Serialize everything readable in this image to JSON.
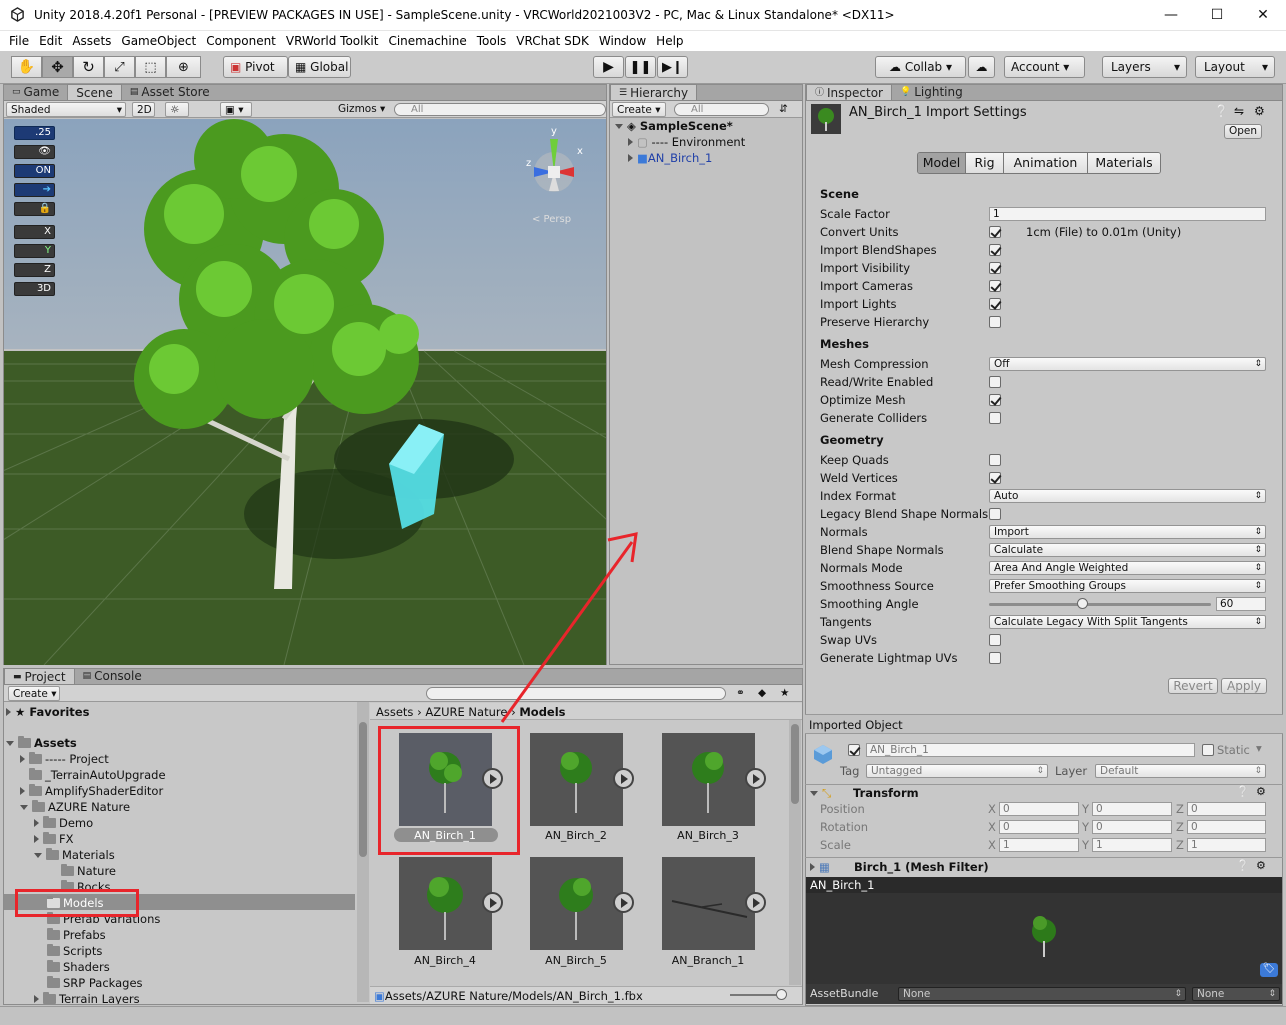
{
  "window": {
    "title": "Unity 2018.4.20f1 Personal - [PREVIEW PACKAGES IN USE] - SampleScene.unity - VRCWorld2021003V2 - PC, Mac & Linux Standalone* <DX11>",
    "minimize": "—",
    "maximize": "☐",
    "close": "✕"
  },
  "menu": [
    "File",
    "Edit",
    "Assets",
    "GameObject",
    "Component",
    "VRWorld Toolkit",
    "Cinemachine",
    "Tools",
    "VRChat SDK",
    "Window",
    "Help"
  ],
  "toolbar": {
    "pivot": "Pivot",
    "global": "Global",
    "collab": "Collab",
    "account": "Account",
    "layers": "Layers",
    "layout": "Layout"
  },
  "scene": {
    "tabs": [
      "Game",
      "Scene",
      "Asset Store"
    ],
    "shaded": "Shaded",
    "mode2d": "2D",
    "gizmos": "Gizmos",
    "search_placeholder": "All",
    "persp": "< Persp",
    "icons": [
      ".25",
      "",
      "ON",
      "",
      "",
      "X",
      "Y",
      "Z",
      "3D"
    ],
    "gizmo_axes": {
      "y": "y",
      "x": "x",
      "z": "z"
    }
  },
  "hierarchy": {
    "tab": "Hierarchy",
    "create": "Create",
    "search_placeholder": "All",
    "scene_name": "SampleScene*",
    "items": [
      "---- Environment",
      "AN_Birch_1"
    ]
  },
  "inspector": {
    "tab1": "Inspector",
    "tab2": "Lighting",
    "title": "AN_Birch_1 Import Settings",
    "open": "Open",
    "tabs": [
      "Model",
      "Rig",
      "Animation",
      "Materials"
    ],
    "scene_head": "Scene",
    "scale_factor": "Scale Factor",
    "scale_value": "1",
    "convert_units": "Convert Units",
    "convert_note": "1cm (File) to 0.01m (Unity)",
    "import_blendshapes": "Import BlendShapes",
    "import_visibility": "Import Visibility",
    "import_cameras": "Import Cameras",
    "import_lights": "Import Lights",
    "preserve_hierarchy": "Preserve Hierarchy",
    "meshes_head": "Meshes",
    "mesh_compression": "Mesh Compression",
    "mesh_compression_value": "Off",
    "read_write": "Read/Write Enabled",
    "optimize_mesh": "Optimize Mesh",
    "generate_colliders": "Generate Colliders",
    "geometry_head": "Geometry",
    "keep_quads": "Keep Quads",
    "weld_vertices": "Weld Vertices",
    "index_format": "Index Format",
    "index_format_value": "Auto",
    "legacy_blend": "Legacy Blend Shape Normals",
    "normals": "Normals",
    "normals_value": "Import",
    "blend_shape_normals": "Blend Shape Normals",
    "blend_shape_normals_value": "Calculate",
    "normals_mode": "Normals Mode",
    "normals_mode_value": "Area And Angle Weighted",
    "smoothness_source": "Smoothness Source",
    "smoothness_source_value": "Prefer Smoothing Groups",
    "smoothing_angle": "Smoothing Angle",
    "smoothing_angle_value": "60",
    "smoothing_angle_fraction": 0.42,
    "tangents": "Tangents",
    "tangents_value": "Calculate Legacy With Split Tangents",
    "swap_uvs": "Swap UVs",
    "generate_lightmap": "Generate Lightmap UVs",
    "revert": "Revert",
    "apply": "Apply",
    "imported_object": "Imported Object",
    "object_name": "AN_Birch_1",
    "static": "Static",
    "tag_label": "Tag",
    "tag_value": "Untagged",
    "layer_label": "Layer",
    "layer_value": "Default",
    "transform": "Transform",
    "position": "Position",
    "rotation": "Rotation",
    "scale": "Scale",
    "x": "X",
    "y": "Y",
    "z": "Z",
    "pos": [
      "0",
      "0",
      "0"
    ],
    "rot": [
      "0",
      "0",
      "0"
    ],
    "scl": [
      "1",
      "1",
      "1"
    ],
    "mesh_filter": "Birch_1 (Mesh Filter)",
    "preview_name": "AN_Birch_1",
    "assetbundle": "AssetBundle",
    "ab_none1": "None",
    "ab_none2": "None"
  },
  "project": {
    "tab1": "Project",
    "tab2": "Console",
    "create": "Create",
    "favorites": "Favorites",
    "assets": "Assets",
    "tree": [
      "----- Project",
      "_TerrainAutoUpgrade",
      "AmplifyShaderEditor",
      "AZURE Nature",
      "Demo",
      "FX",
      "Materials",
      "Nature",
      "Rocks",
      "Models",
      "Prefab Variations",
      "Prefabs",
      "Scripts",
      "Shaders",
      "SRP Packages",
      "Terrain Layers"
    ],
    "breadcrumb": [
      "Assets",
      "AZURE Nature",
      "Models"
    ],
    "thumbs": [
      "AN_Birch_1",
      "AN_Birch_2",
      "AN_Birch_3",
      "AN_Birch_4",
      "AN_Birch_5",
      "AN_Branch_1"
    ],
    "path": "Assets/AZURE Nature/Models/AN_Birch_1.fbx"
  },
  "colors": {
    "highlight": "#e8252b",
    "selected_blue": "#3c7ad8"
  }
}
